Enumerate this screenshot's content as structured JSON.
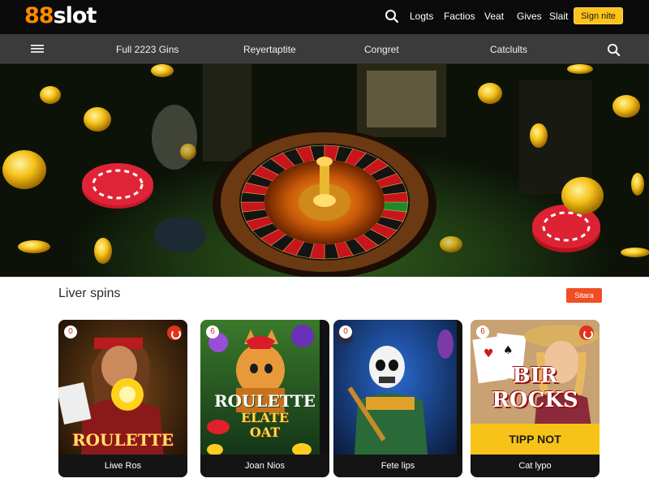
{
  "header": {
    "logo_number": "88",
    "logo_word": "slot",
    "links": [
      "Logts",
      "Factios",
      "Veat",
      "Gives",
      "Slait"
    ],
    "signup_label": "Sign nite"
  },
  "nav": {
    "items": [
      "Full 2223 Gins",
      "Reyertaptite",
      "Congret",
      "Catclults"
    ]
  },
  "section": {
    "title": "Liver spins",
    "more_label": "Sitara"
  },
  "cards": [
    {
      "badge": "0",
      "art_title": "ROULETTE",
      "art_subtitle": "",
      "label": "Liwe Ros"
    },
    {
      "badge": "6",
      "art_title": "ROULETTE",
      "art_subtitle": "ELATE OAT",
      "label": "Joan Nios"
    },
    {
      "badge": "0",
      "art_title": "",
      "art_subtitle": "",
      "label": "Fete lips"
    },
    {
      "badge": "6",
      "art_title": "BIR ROCKS",
      "art_subtitle": "",
      "tip_label": "TIPP NOT",
      "label": "Cat lypo"
    }
  ],
  "colors": {
    "brand_orange": "#ff8a00",
    "signup_yellow": "#ffc21a",
    "more_red": "#f04e23",
    "topbar_bg": "#0b0b0b",
    "navbar_bg": "#3b3b3b"
  }
}
